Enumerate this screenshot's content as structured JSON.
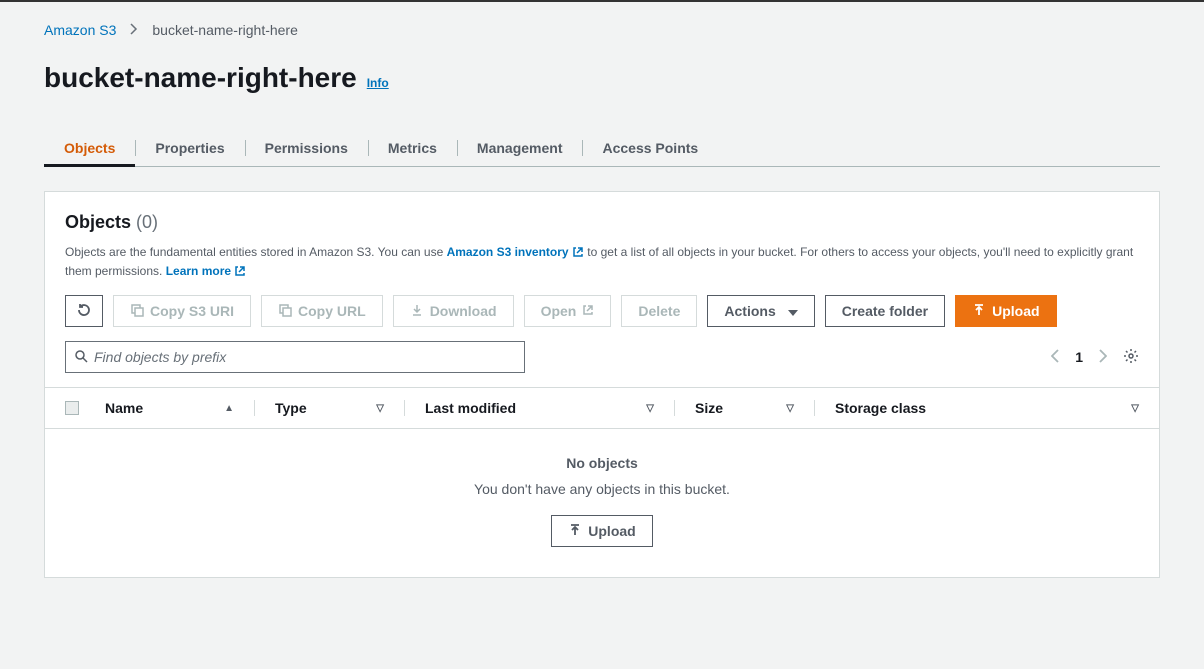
{
  "breadcrumb": {
    "root": "Amazon S3",
    "current": "bucket-name-right-here"
  },
  "header": {
    "title": "bucket-name-right-here",
    "info": "Info"
  },
  "tabs": [
    "Objects",
    "Properties",
    "Permissions",
    "Metrics",
    "Management",
    "Access Points"
  ],
  "panel": {
    "title": "Objects",
    "count": "(0)",
    "desc_a": "Objects are the fundamental entities stored in Amazon S3. You can use ",
    "link_inventory": "Amazon S3 inventory",
    "desc_b": " to get a list of all objects in your bucket. For others to access your objects, you'll need to explicitly grant them permissions. ",
    "link_learn": "Learn more"
  },
  "toolbar": {
    "copy_uri": "Copy S3 URI",
    "copy_url": "Copy URL",
    "download": "Download",
    "open": "Open",
    "delete": "Delete",
    "actions": "Actions",
    "create_folder": "Create folder",
    "upload": "Upload"
  },
  "search": {
    "placeholder": "Find objects by prefix"
  },
  "pager": {
    "page": "1"
  },
  "columns": {
    "name": "Name",
    "type": "Type",
    "modified": "Last modified",
    "size": "Size",
    "storage": "Storage class"
  },
  "empty": {
    "title": "No objects",
    "sub": "You don't have any objects in this bucket.",
    "upload": "Upload"
  }
}
